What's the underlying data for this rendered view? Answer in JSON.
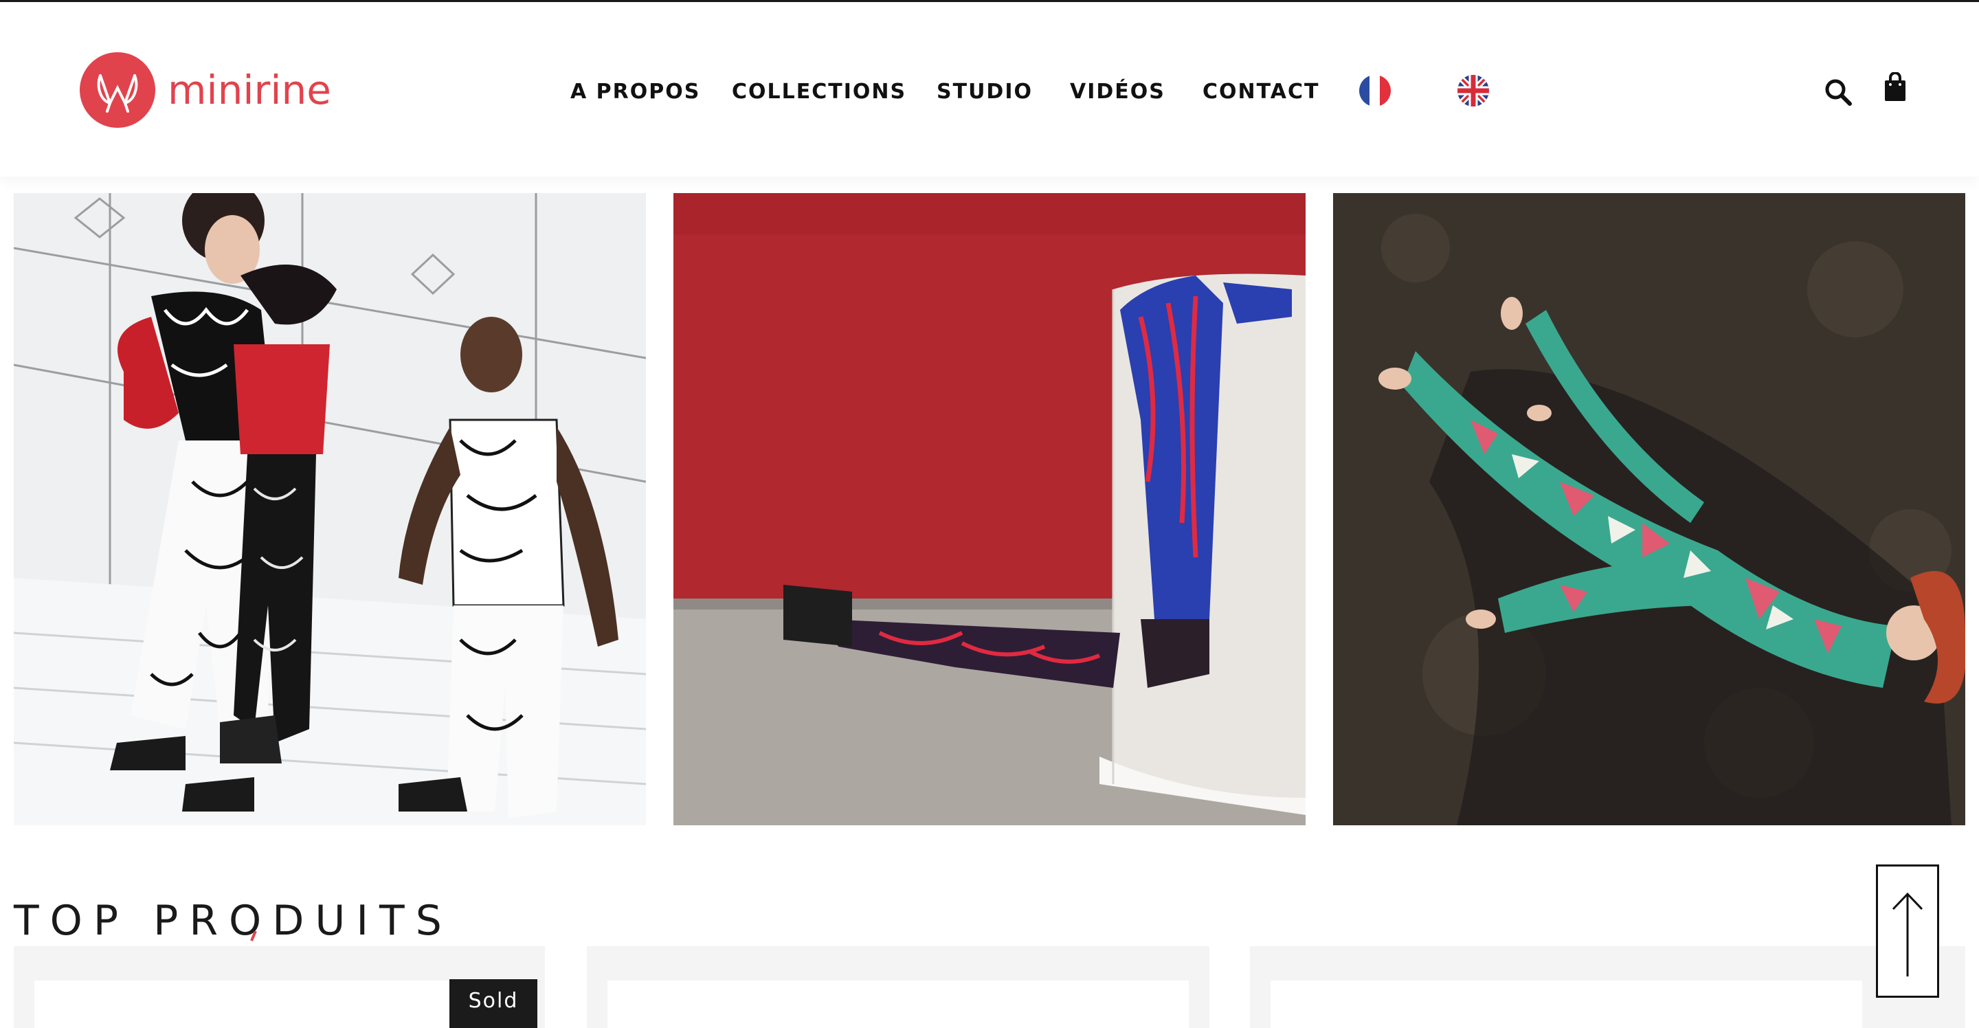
{
  "brand": {
    "name": "minirine",
    "color": "#e1434d",
    "logo_icon": "minirine-logo-icon"
  },
  "nav": {
    "items": [
      {
        "label": "A PROPOS"
      },
      {
        "label": "COLLECTIONS"
      },
      {
        "label": "STUDIO"
      },
      {
        "label": "VIDÉOS"
      },
      {
        "label": "CONTACT"
      }
    ],
    "languages": [
      {
        "code": "fr",
        "icon": "france-flag-icon"
      },
      {
        "code": "en",
        "icon": "uk-flag-icon"
      }
    ],
    "search_icon": "search-icon",
    "cart_icon": "shopping-bag-icon"
  },
  "gallery": [
    {
      "image": "photo-group-black-white-print"
    },
    {
      "image": "photo-blue-red-leggings-red-wall"
    },
    {
      "image": "photo-green-bodysuit-on-ground"
    }
  ],
  "top_products": {
    "title": "TOP PRODUITS",
    "cards": [
      {
        "badge": "Sold"
      },
      {
        "badge": ""
      },
      {
        "badge": ""
      }
    ]
  },
  "scroll_top_icon": "arrow-up-icon",
  "colors": {
    "accent": "#e1434d",
    "text": "#111111",
    "card_bg": "#f4f4f4",
    "badge_bg": "#1b1b1b"
  }
}
